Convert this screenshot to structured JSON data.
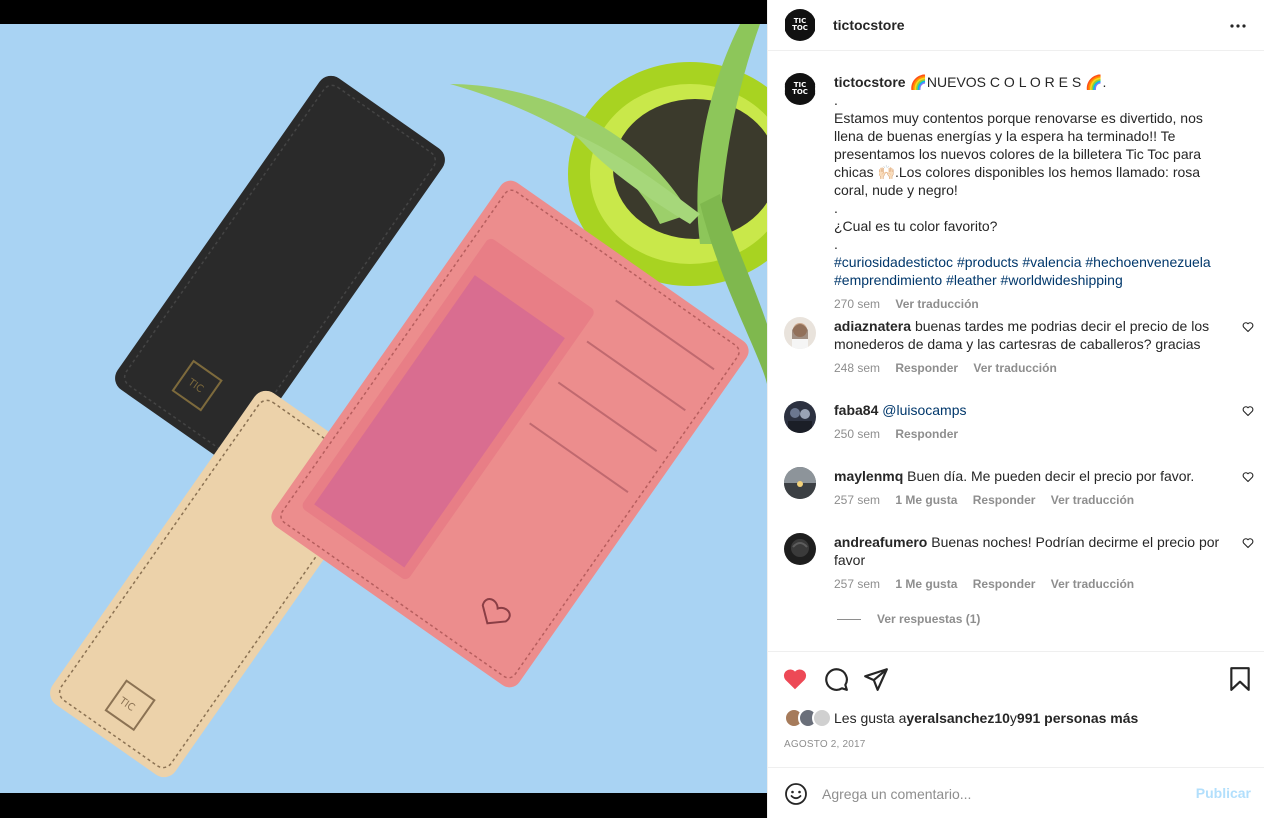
{
  "header": {
    "username": "tictocstore"
  },
  "logo_text": "TIC TOC",
  "caption": {
    "username": "tictocstore",
    "title": "🌈NUEVOS C O L O R E S 🌈.",
    "text": ".\nEstamos muy contentos porque renovarse es divertido, nos llena de buenas energías y la espera ha terminado!! Te presentamos los nuevos colores de la billetera Tic Toc para chicas 🙌🏻.Los colores disponibles los hemos llamado: rosa coral, nude y negro!\n.\n¿Cual es tu color favorito?\n.",
    "hashtags": [
      "#curiosidadestictoc",
      "#products",
      "#valencia",
      "#hechoenvenezuela",
      "#emprendimiento",
      "#leather",
      "#worldwideshipping"
    ],
    "time": "270 sem",
    "translate": "Ver traducción"
  },
  "comments": [
    {
      "username": "adiaznatera",
      "text": "buenas tardes me podrias decir el precio de los monederos de dama y las cartesras de caballeros? gracias",
      "time": "248 sem",
      "likes": "",
      "reply": "Responder",
      "translate": "Ver traducción"
    },
    {
      "username": "faba84",
      "text": "@luisocamps",
      "time": "250 sem",
      "likes": "",
      "reply": "Responder",
      "translate": ""
    },
    {
      "username": "maylenmq",
      "text": "Buen día. Me pueden decir el precio por favor.",
      "time": "257 sem",
      "likes": "1 Me gusta",
      "reply": "Responder",
      "translate": "Ver traducción"
    },
    {
      "username": "andreafumero",
      "text": "Buenas noches! Podrían decirme el precio por favor",
      "time": "257 sem",
      "likes": "1 Me gusta",
      "reply": "Responder",
      "translate": "Ver traducción"
    }
  ],
  "view_replies": "Ver respuestas (1)",
  "likes": {
    "prefix": "Les gusta a ",
    "user": "yeralsanchez10",
    "middle": " y ",
    "others": "991 personas más"
  },
  "date": "AGOSTO 2, 2017",
  "composer": {
    "placeholder": "Agrega un comentario...",
    "post_label": "Publicar"
  },
  "colors": {
    "liked_heart": "#ed4956",
    "link": "#00376b",
    "post_button": "#b2dffc",
    "muted": "#8e8e8e"
  },
  "icons": [
    "more-icon",
    "heart-icon",
    "comment-icon",
    "share-icon",
    "bookmark-icon",
    "emoji-icon"
  ]
}
